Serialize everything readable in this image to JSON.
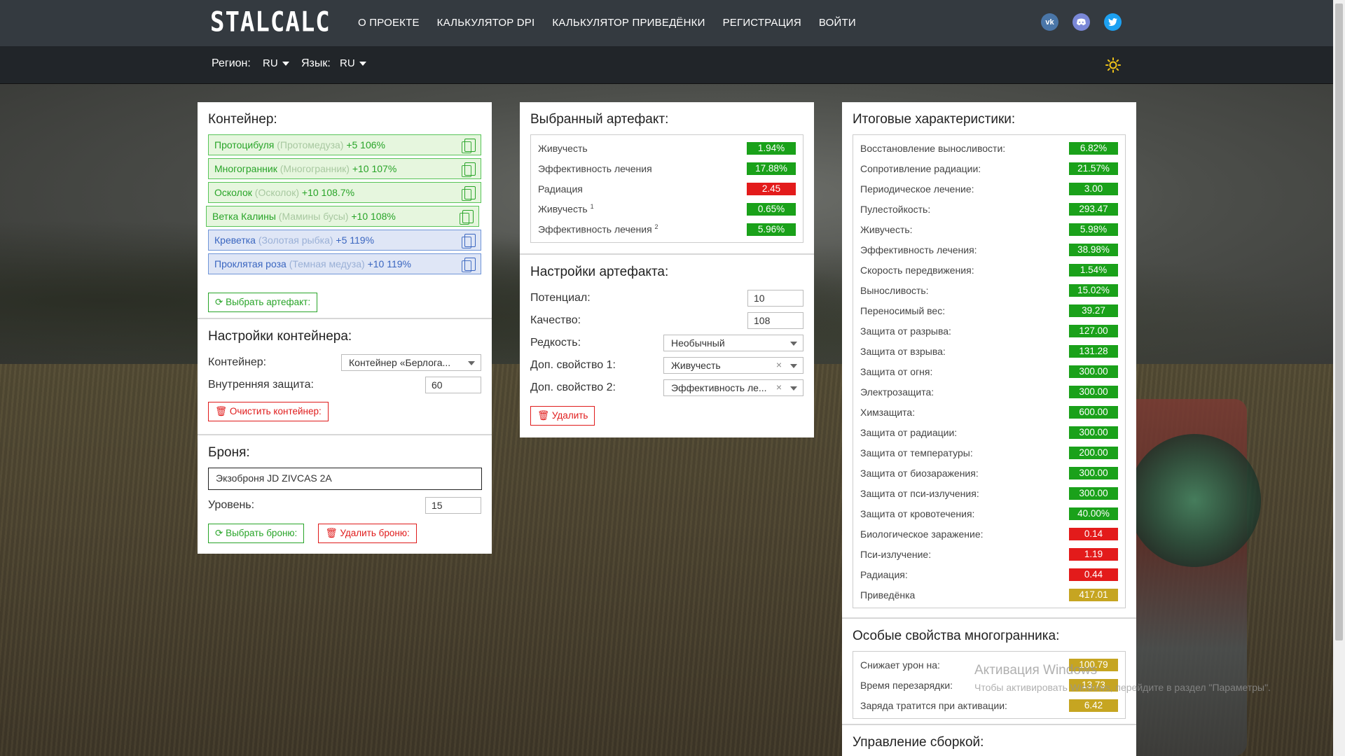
{
  "nav": {
    "logo": "STALCALC",
    "items": [
      "О ПРОЕКТЕ",
      "КАЛЬКУЛЯТОР DPI",
      "КАЛЬКУЛЯТОР ПРИВЕДЁНКИ",
      "РЕГИСТРАЦИЯ",
      "ВОЙТИ"
    ],
    "socials": [
      "vk-icon",
      "discord-icon",
      "twitter-icon"
    ]
  },
  "subbar": {
    "region_label": "Регион:",
    "region_value": "RU",
    "lang_label": "Язык:",
    "lang_value": "RU"
  },
  "container_card": {
    "title": "Контейнер:",
    "artifacts": [
      {
        "name": "Протоцибуля",
        "orig": "(Протомедуза)",
        "info": "+5 106%",
        "color": "green"
      },
      {
        "name": "Многогранник",
        "orig": "(Многогранник)",
        "info": "+10 107%",
        "color": "green"
      },
      {
        "name": "Осколок",
        "orig": "(Осколок)",
        "info": "+10 108.7%",
        "color": "green"
      },
      {
        "name": "Ветка Калины",
        "orig": "(Мамины бусы)",
        "info": "+10 108%",
        "color": "green"
      },
      {
        "name": "Креветка",
        "orig": "(Золотая рыбка)",
        "info": "+5 119%",
        "color": "blue"
      },
      {
        "name": "Проклятая роза",
        "orig": "(Темная медуза)",
        "info": "+10 119%",
        "color": "blue"
      }
    ],
    "select_artifact_button": "Выбрать артефакт:",
    "settings_title": "Настройки контейнера:",
    "container_label": "Контейнер:",
    "container_value": "Контейнер «Берлога...",
    "inner_protection_label": "Внутренняя защита:",
    "inner_protection_value": "60",
    "clear_button": "Очистить контейнер:",
    "armor_title": "Броня:",
    "armor_value": "Экзоброня JD ZIVCAS 2A",
    "level_label": "Уровень:",
    "level_value": "15",
    "select_armor_button": "Выбрать броню:",
    "delete_armor_button": "Удалить броню:"
  },
  "selected_card": {
    "title": "Выбранный артефакт:",
    "stats": [
      {
        "label": "Живучесть",
        "sup": "",
        "value": "1.94%",
        "color": "green"
      },
      {
        "label": "Эффективность лечения",
        "sup": "",
        "value": "17.88%",
        "color": "green"
      },
      {
        "label": "Радиация",
        "sup": "",
        "value": "2.45",
        "color": "red"
      },
      {
        "label": "Живучесть",
        "sup": "1",
        "value": "0.65%",
        "color": "green"
      },
      {
        "label": "Эффективность лечения",
        "sup": "2",
        "value": "5.96%",
        "color": "green"
      }
    ],
    "settings_title": "Настройки артефакта:",
    "potential_label": "Потенциал:",
    "potential_value": "10",
    "quality_label": "Качество:",
    "quality_value": "108",
    "rarity_label": "Редкость:",
    "rarity_value": "Необычный",
    "extra1_label": "Доп. свойство 1:",
    "extra1_value": "Живучесть",
    "extra2_label": "Доп. свойство 2:",
    "extra2_value": "Эффективность ле...",
    "delete_button": "Удалить"
  },
  "totals_card": {
    "title": "Итоговые характеристики:",
    "stats": [
      {
        "label": "Восстановление выносливости:",
        "value": "6.82%",
        "color": "green"
      },
      {
        "label": "Сопротивление радиации:",
        "value": "21.57%",
        "color": "green"
      },
      {
        "label": "Периодическое лечение:",
        "value": "3.00",
        "color": "green"
      },
      {
        "label": "Пулестойкость:",
        "value": "293.47",
        "color": "green"
      },
      {
        "label": "Живучесть:",
        "value": "5.98%",
        "color": "green"
      },
      {
        "label": "Эффективность лечения:",
        "value": "38.98%",
        "color": "green"
      },
      {
        "label": "Скорость передвижения:",
        "value": "1.54%",
        "color": "green"
      },
      {
        "label": "Выносливость:",
        "value": "15.02%",
        "color": "green"
      },
      {
        "label": "Переносимый вес:",
        "value": "39.27",
        "color": "green"
      },
      {
        "label": "Защита от разрыва:",
        "value": "127.00",
        "color": "green"
      },
      {
        "label": "Защита от взрыва:",
        "value": "131.28",
        "color": "green"
      },
      {
        "label": "Защита от огня:",
        "value": "300.00",
        "color": "green"
      },
      {
        "label": "Электрозащита:",
        "value": "300.00",
        "color": "green"
      },
      {
        "label": "Химзащита:",
        "value": "600.00",
        "color": "green"
      },
      {
        "label": "Защита от радиации:",
        "value": "300.00",
        "color": "green"
      },
      {
        "label": "Защита от температуры:",
        "value": "200.00",
        "color": "green"
      },
      {
        "label": "Защита от биозаражения:",
        "value": "300.00",
        "color": "green"
      },
      {
        "label": "Защита от пси-излучения:",
        "value": "300.00",
        "color": "green"
      },
      {
        "label": "Защита от кровотечения:",
        "value": "40.00%",
        "color": "green"
      },
      {
        "label": "Биологическое заражение:",
        "value": "0.14",
        "color": "red"
      },
      {
        "label": "Пси-излучение:",
        "value": "1.19",
        "color": "red"
      },
      {
        "label": "Радиация:",
        "value": "0.44",
        "color": "red"
      },
      {
        "label": "Приведёнка",
        "value": "417.01",
        "color": "gold"
      }
    ],
    "special_title": "Особые свойства многогранника:",
    "special_stats": [
      {
        "label": "Снижает урон на:",
        "value": "100.79",
        "color": "gold"
      },
      {
        "label": "Время перезарядки:",
        "value": "13.73",
        "color": "gold"
      },
      {
        "label": "Заряда тратится при активации:",
        "value": "6.42",
        "color": "gold"
      }
    ],
    "build_title": "Управление сборкой:"
  },
  "watermark": {
    "line1": "Активация Windows",
    "line2": "Чтобы активировать Windows, перейдите в раздел \"Параметры\"."
  },
  "colors": {
    "green": "#1aa11a",
    "red": "#e31b1b",
    "gold": "#c6a521",
    "navbar": "#343a40",
    "subbar": "#212529"
  }
}
